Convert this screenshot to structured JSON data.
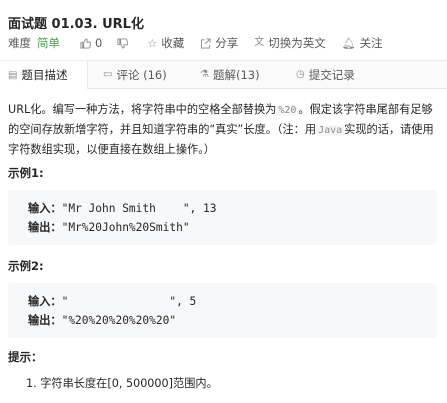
{
  "problem": {
    "title": "面试题 01.03. URL化",
    "difficulty_label": "难度",
    "difficulty": "简单",
    "likes": "0",
    "favorite": "收藏",
    "share": "分享",
    "translate": "切换为英文",
    "follow": "关注"
  },
  "tabs": [
    {
      "label": "题目描述"
    },
    {
      "label": "评论 (16)"
    },
    {
      "label": "题解(13)"
    },
    {
      "label": "提交记录"
    }
  ],
  "description": {
    "p1": "URL化。编写一种方法，将字符串中的空格全部替换为",
    "code1": "%20",
    "p2": "。假定该字符串尾部有足够的空间存放新增字符，并且知道字符串的“真实”长度。（注：用",
    "code2": "Java",
    "p3": "实现的话，请使用字符数组实现，以便直接在数组上操作。）"
  },
  "examples": [
    {
      "heading": "示例1:",
      "input_label": "输入：",
      "input": "\"Mr John Smith    \", 13",
      "output_label": "输出：",
      "output": "\"Mr%20John%20Smith\""
    },
    {
      "heading": "示例2:",
      "input_label": "输入：",
      "input": "\"               \", 5",
      "output_label": "输出：",
      "output": "\"%20%20%20%20%20\""
    }
  ],
  "tips": {
    "heading": "提示：",
    "items": [
      "字符串长度在[0, 500000]范围内。"
    ]
  },
  "colors": {
    "easy": "#43a047",
    "text": "#262626",
    "muted": "#595959",
    "code_bg": "#f7f8fa"
  }
}
